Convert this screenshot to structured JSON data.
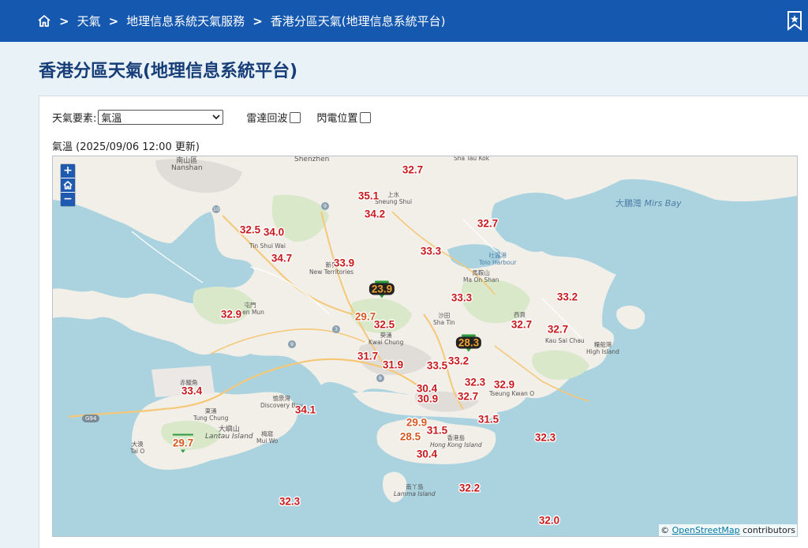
{
  "breadcrumb": {
    "home_icon": "home-icon",
    "items": [
      "天氣",
      "地理信息系統天氣服務",
      "香港分區天氣(地理信息系統平台)"
    ]
  },
  "header": {
    "bookmark_icon": "bookmark-star-icon",
    "accent": "#1558b0"
  },
  "page": {
    "title": "香港分區天氣(地理信息系統平台)"
  },
  "controls": {
    "element_label": "天氣要素:",
    "element_selected": "氣溫",
    "radar_label": "雷達回波",
    "radar_checked": false,
    "lightning_label": "閃電位置",
    "lightning_checked": false
  },
  "caption": "氣溫 (2025/09/06 12:00 更新)",
  "map": {
    "zoom_in": "+",
    "home": "home-icon",
    "zoom_out": "−",
    "attribution_prefix": "© ",
    "attribution_link": "OpenStreetMap",
    "attribution_suffix": " contributors",
    "colors": {
      "sea": "#aad3df",
      "land": "#f2efe9",
      "green": "#d8e8c8",
      "value_hot": "#c8191c",
      "value_cool": "#d65a24",
      "marker": "#2e9a3c"
    },
    "place_labels": [
      {
        "id": "nanshan",
        "text": "Nanshan",
        "sub": "南山區"
      },
      {
        "id": "shenzhen",
        "text": "Shenzhen"
      },
      {
        "id": "sha-tau-kok",
        "text": "Sha Tau Kok"
      },
      {
        "id": "sheung-shui",
        "text": "Sheung Shui",
        "sub": "上水"
      },
      {
        "id": "tin-shui-wai",
        "text": "Tin Shui Wai"
      },
      {
        "id": "new-territories",
        "text": "New Territories",
        "sub": "新界"
      },
      {
        "id": "tuen-mun",
        "text": "Tuen Mun",
        "sub": "屯門"
      },
      {
        "id": "kwai-chung",
        "text": "Kwai Chung",
        "sub": "葵涌"
      },
      {
        "id": "sha-tin",
        "text": "Sha Tin",
        "sub": "沙田"
      },
      {
        "id": "ma-on-shan",
        "text": "Ma On Shan",
        "sub": "馬鞍山"
      },
      {
        "id": "tolo-harbour",
        "text": "Tolo Harbour",
        "sub": "吐露港"
      },
      {
        "id": "sai-kung",
        "text": "西貢"
      },
      {
        "id": "kau-sai-chau",
        "text": "Kau Sai Chau"
      },
      {
        "id": "high-island",
        "text": "High Island",
        "sub": "糧船灣"
      },
      {
        "id": "chek-lap-kok",
        "text": "赤鱲角"
      },
      {
        "id": "discovery-bay",
        "text": "Discovery Bay",
        "sub": "愉景灣"
      },
      {
        "id": "tung-chung",
        "text": "Tung Chung",
        "sub": "東涌"
      },
      {
        "id": "lantau",
        "text": "Lantau Island",
        "sub": "大嶼山"
      },
      {
        "id": "mui-wo",
        "text": "Mui Wo",
        "sub": "梅窩"
      },
      {
        "id": "tai-o",
        "text": "Tai O",
        "sub": "大澳"
      },
      {
        "id": "hong-kong-island",
        "text": "Hong Kong Island",
        "sub": "香港島"
      },
      {
        "id": "tseung-kwan-o",
        "text": "Tseung Kwan O"
      },
      {
        "id": "lamma",
        "text": "Lamma Island",
        "sub": "南丫島"
      },
      {
        "id": "mirs-bay",
        "text": "Mirs Bay",
        "sub": "大鵬灣"
      }
    ],
    "road_labels": [
      "10",
      "9",
      "3",
      "9",
      "8",
      "G94"
    ],
    "temperatures": [
      {
        "id": "t01",
        "value": "32.7",
        "style": "hot"
      },
      {
        "id": "t02",
        "value": "35.1",
        "style": "hot"
      },
      {
        "id": "t03",
        "value": "34.2",
        "style": "hot"
      },
      {
        "id": "t04",
        "value": "32.7",
        "style": "hot"
      },
      {
        "id": "t05",
        "value": "32.5",
        "style": "hot"
      },
      {
        "id": "t06",
        "value": "34.0",
        "style": "hot"
      },
      {
        "id": "t07",
        "value": "34.7",
        "style": "hot"
      },
      {
        "id": "t08",
        "value": "33.9",
        "style": "hot"
      },
      {
        "id": "t09",
        "value": "33.3",
        "style": "hot"
      },
      {
        "id": "t10",
        "value": "23.9",
        "style": "highlight"
      },
      {
        "id": "t11",
        "value": "33.3",
        "style": "hot"
      },
      {
        "id": "t12",
        "value": "33.2",
        "style": "hot"
      },
      {
        "id": "t13",
        "value": "32.9",
        "style": "hot"
      },
      {
        "id": "t14",
        "value": "29.7",
        "style": "cool"
      },
      {
        "id": "t15",
        "value": "32.5",
        "style": "hot"
      },
      {
        "id": "t16",
        "value": "32.7",
        "style": "hot"
      },
      {
        "id": "t17",
        "value": "32.7",
        "style": "hot"
      },
      {
        "id": "t18",
        "value": "28.3",
        "style": "highlight"
      },
      {
        "id": "t19",
        "value": "31.7",
        "style": "hot"
      },
      {
        "id": "t20",
        "value": "31.9",
        "style": "hot"
      },
      {
        "id": "t21",
        "value": "33.5",
        "style": "hot"
      },
      {
        "id": "t22",
        "value": "33.2",
        "style": "hot"
      },
      {
        "id": "t23",
        "value": "33.4",
        "style": "hot"
      },
      {
        "id": "t24",
        "value": "30.4",
        "style": "hot"
      },
      {
        "id": "t25",
        "value": "32.3",
        "style": "hot"
      },
      {
        "id": "t26",
        "value": "32.9",
        "style": "hot"
      },
      {
        "id": "t27",
        "value": "30.9",
        "style": "hot"
      },
      {
        "id": "t28",
        "value": "32.7",
        "style": "hot"
      },
      {
        "id": "t29",
        "value": "34.1",
        "style": "hot"
      },
      {
        "id": "t30",
        "value": "29.9",
        "style": "cool"
      },
      {
        "id": "t31",
        "value": "31.5",
        "style": "hot"
      },
      {
        "id": "t32",
        "value": "31.5",
        "style": "hot"
      },
      {
        "id": "t33",
        "value": "28.5",
        "style": "cool"
      },
      {
        "id": "t34",
        "value": "30.4",
        "style": "hot"
      },
      {
        "id": "t35",
        "value": "32.3",
        "style": "hot"
      },
      {
        "id": "t36",
        "value": "29.7",
        "style": "marker"
      },
      {
        "id": "t37",
        "value": "32.2",
        "style": "hot"
      },
      {
        "id": "t38",
        "value": "32.3",
        "style": "hot"
      },
      {
        "id": "t39",
        "value": "32.0",
        "style": "hot"
      }
    ]
  }
}
